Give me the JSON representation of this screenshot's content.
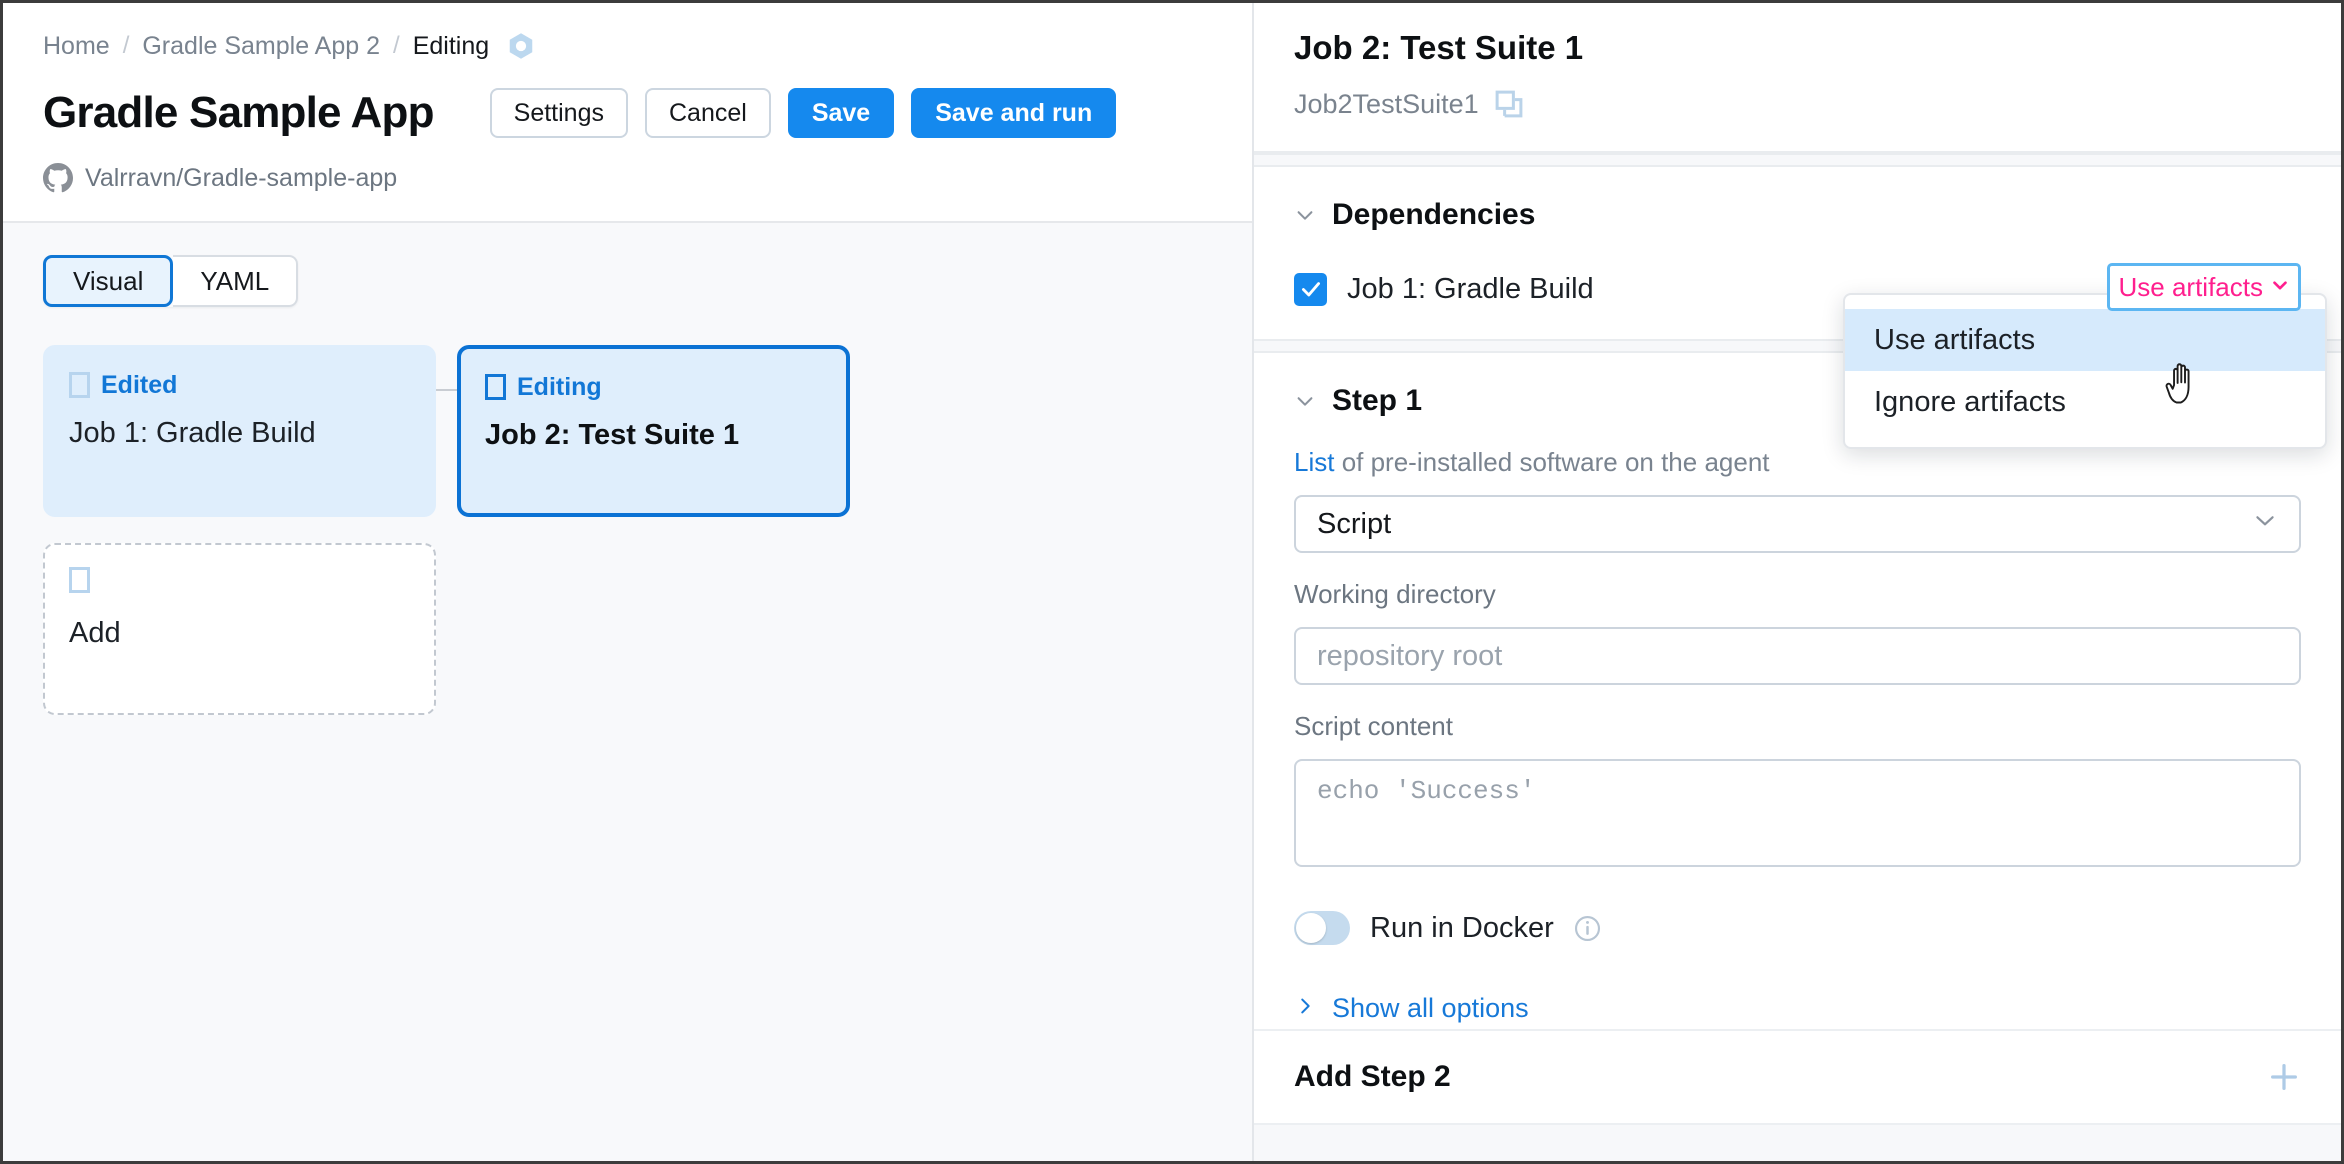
{
  "breadcrumb": {
    "home": "Home",
    "project": "Gradle Sample App 2",
    "current": "Editing",
    "separator": "/",
    "icon": "hexagon-icon"
  },
  "header": {
    "title": "Gradle Sample App",
    "repo": "Valrravn/Gradle-sample-app",
    "repo_icon": "github-icon",
    "buttons": {
      "settings": "Settings",
      "cancel": "Cancel",
      "save": "Save",
      "save_and_run": "Save and run"
    }
  },
  "editor": {
    "tabs": [
      {
        "label": "Visual",
        "active": true
      },
      {
        "label": "YAML",
        "active": false
      }
    ],
    "jobs": [
      {
        "status": "Edited",
        "name": "Job 1: Gradle Build",
        "state": "edited"
      },
      {
        "status": "Editing",
        "name": "Job 2: Test Suite 1",
        "state": "editing"
      }
    ],
    "add_card": {
      "label": "Add"
    }
  },
  "panel": {
    "title": "Job 2: Test Suite 1",
    "id": "Job2TestSuite1",
    "copy_icon": "copy-icon",
    "dependencies": {
      "heading": "Dependencies",
      "items": [
        {
          "label": "Job 1: Gradle Build",
          "checked": true,
          "artifact_mode": "Use artifacts"
        }
      ],
      "dropdown_options": [
        {
          "label": "Use artifacts",
          "highlighted": true
        },
        {
          "label": "Ignore artifacts",
          "highlighted": false
        }
      ]
    },
    "step": {
      "heading": "Step 1",
      "hint_link": "List",
      "hint_text": " of pre-installed software on the agent",
      "type_value": "Script",
      "working_directory": {
        "label": "Working directory",
        "placeholder": "repository root",
        "value": ""
      },
      "script_content": {
        "label": "Script content",
        "placeholder": "echo 'Success'",
        "value": ""
      },
      "docker": {
        "label": "Run in Docker",
        "enabled": false,
        "info_icon": "info-icon"
      },
      "show_all_options": "Show all options"
    },
    "add_step": {
      "label": "Add Step 2",
      "icon": "plus-icon"
    }
  },
  "colors": {
    "accent_blue": "#1589ee",
    "border_blue": "#5cb6f2",
    "magenta": "#ff1f8e",
    "card_blue": "#dfeefc",
    "link_blue": "#1779d8"
  }
}
